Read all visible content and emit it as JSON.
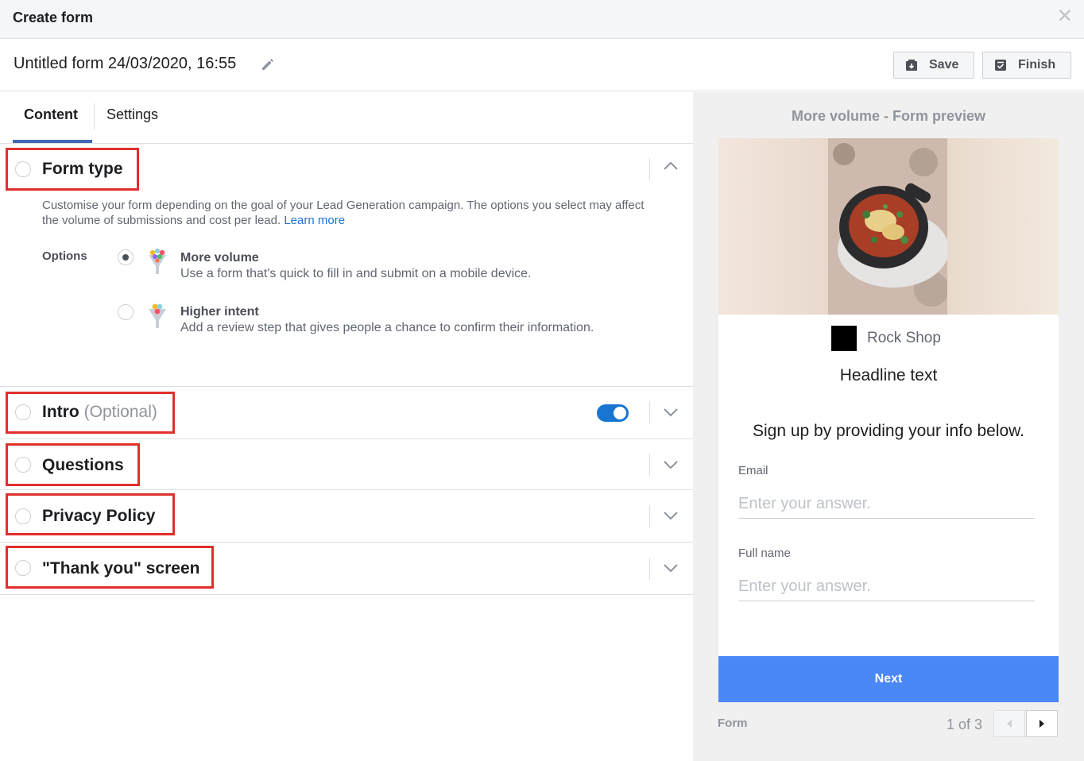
{
  "window": {
    "title": "Create form",
    "close_icon": "close-icon"
  },
  "form": {
    "name": "Untitled form 24/03/2020, 16:55",
    "save_label": "Save",
    "finish_label": "Finish"
  },
  "tabs": [
    {
      "label": "Content",
      "active": true
    },
    {
      "label": "Settings",
      "active": false
    }
  ],
  "sections": {
    "form_type": {
      "title": "Form type",
      "description": "Customise your form depending on the goal of your Lead Generation campaign. The options you select may affect the volume of submissions and cost per lead.",
      "learn_more": "Learn more",
      "options_label": "Options",
      "options": [
        {
          "title": "More volume",
          "subtitle": "Use a form that's quick to fill in and submit on a mobile device.",
          "selected": true
        },
        {
          "title": "Higher intent",
          "subtitle": "Add a review step that gives people a chance to confirm their information.",
          "selected": false
        }
      ]
    },
    "intro": {
      "title": "Intro",
      "optional": "(Optional)",
      "enabled": true
    },
    "questions": {
      "title": "Questions"
    },
    "privacy": {
      "title": "Privacy Policy"
    },
    "thankyou": {
      "title": "\"Thank you\" screen"
    }
  },
  "preview": {
    "title": "More volume - Form preview",
    "brand": "Rock Shop",
    "headline": "Headline text",
    "signup": "Sign up by providing your info below.",
    "fields": [
      {
        "label": "Email",
        "placeholder": "Enter your answer."
      },
      {
        "label": "Full name",
        "placeholder": "Enter your answer."
      }
    ],
    "next_label": "Next",
    "footer_label": "Form",
    "pager": "1 of 3"
  },
  "colors": {
    "accent": "#4267b2",
    "link": "#1876d2",
    "highlight": "#e0302b",
    "next_button": "#4a87f7"
  }
}
